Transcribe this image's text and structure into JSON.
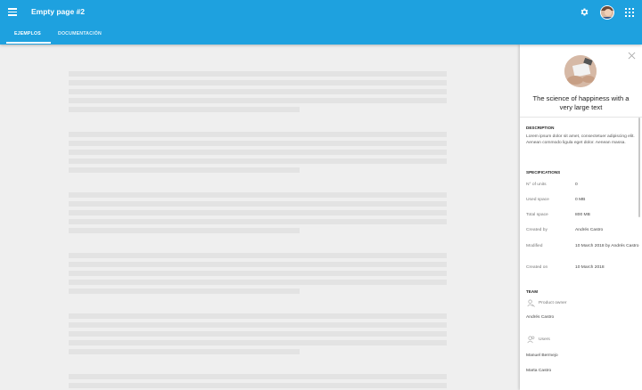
{
  "header": {
    "title": "Empty page #2",
    "tabs": [
      {
        "label": "EJEMPLOS",
        "active": true
      },
      {
        "label": "DOCUMENTACIÓN",
        "active": false
      }
    ],
    "icons": [
      "menu-icon",
      "gear-icon",
      "avatar",
      "apps-icon"
    ],
    "accent_color": "#1ea1df"
  },
  "panel": {
    "title": "The science of happiness with a very large text",
    "description": {
      "heading": "DESCRIPTION",
      "text": "Lorem ipsum dolor sit amet, consectetuer adipiscing elit. Aenean commodo ligula eget dolor. Aenean massa."
    },
    "specifications": {
      "heading": "SPECIFICATIONS",
      "rows": [
        {
          "label": "N° of units",
          "value": "0"
        },
        {
          "label": "Used space",
          "value": "0 MB"
        },
        {
          "label": "Total space",
          "value": "800 MB"
        },
        {
          "label": "Created by",
          "value": "Andrés Castro"
        },
        {
          "label": "Modified",
          "value": "10 March 2018 by Andrés Castro"
        },
        {
          "label": "Created on",
          "value": "10 March 2018"
        }
      ]
    },
    "team": {
      "heading": "TEAM",
      "owner_label": "Product owner",
      "owner": "Andrés Castro",
      "users_label": "Users",
      "users": [
        "Manuel Bermejo",
        "Marta Castro"
      ]
    }
  }
}
